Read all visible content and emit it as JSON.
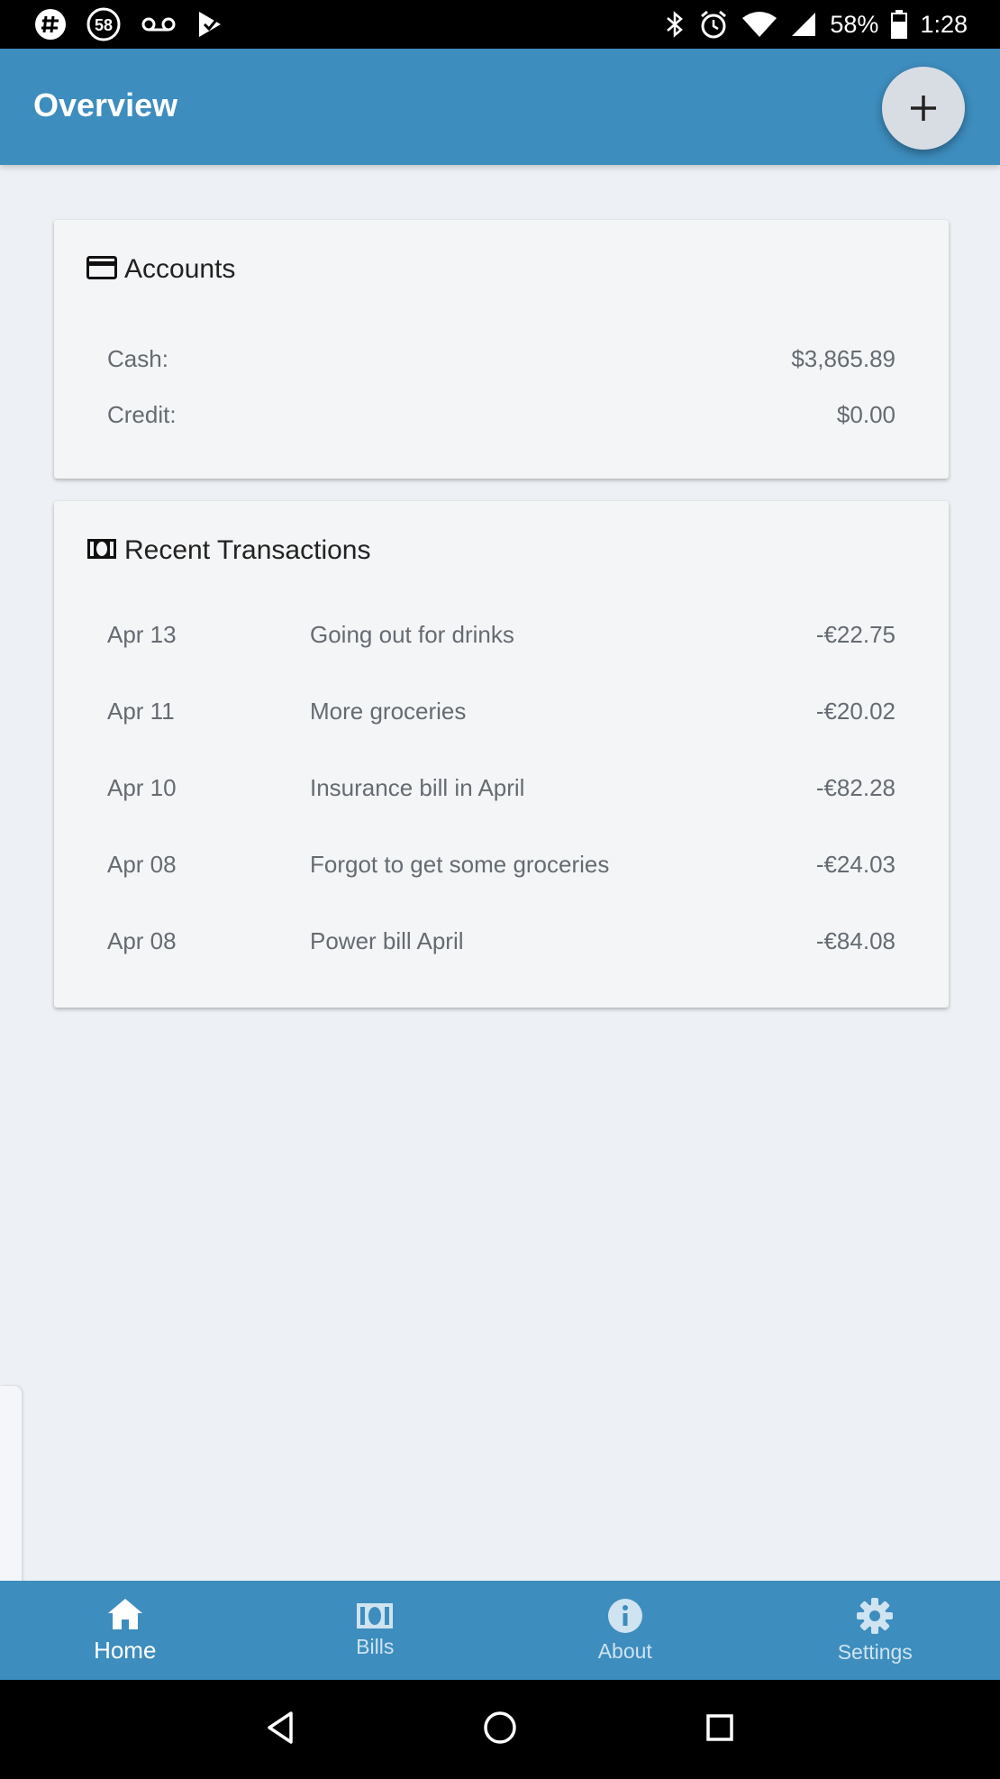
{
  "status_bar": {
    "notif_badge": "58",
    "battery": "58%",
    "time": "1:28"
  },
  "app_bar": {
    "title": "Overview",
    "add_label": "+"
  },
  "accounts": {
    "title": "Accounts",
    "rows": [
      {
        "label": "Cash:",
        "value": "$3,865.89"
      },
      {
        "label": "Credit:",
        "value": "$0.00"
      }
    ]
  },
  "transactions": {
    "title": "Recent Transactions",
    "rows": [
      {
        "date": "Apr 13",
        "description": "Going out for drinks",
        "amount": "-€22.75"
      },
      {
        "date": "Apr 11",
        "description": "More groceries",
        "amount": "-€20.02"
      },
      {
        "date": "Apr 10",
        "description": "Insurance bill in April",
        "amount": "-€82.28"
      },
      {
        "date": "Apr 08",
        "description": "Forgot to get some groceries",
        "amount": "-€24.03"
      },
      {
        "date": "Apr 08",
        "description": "Power bill April",
        "amount": "-€84.08"
      }
    ]
  },
  "bottom_nav": {
    "items": [
      {
        "label": "Home",
        "icon": "home-icon",
        "active": true
      },
      {
        "label": "Bills",
        "icon": "money-icon",
        "active": false
      },
      {
        "label": "About",
        "icon": "info-icon",
        "active": false
      },
      {
        "label": "Settings",
        "icon": "gear-icon",
        "active": false
      }
    ]
  },
  "colors": {
    "primary": "#3d8dbe",
    "background": "#edf0f4",
    "card": "#f4f5f6",
    "fab": "#d8dde3"
  }
}
